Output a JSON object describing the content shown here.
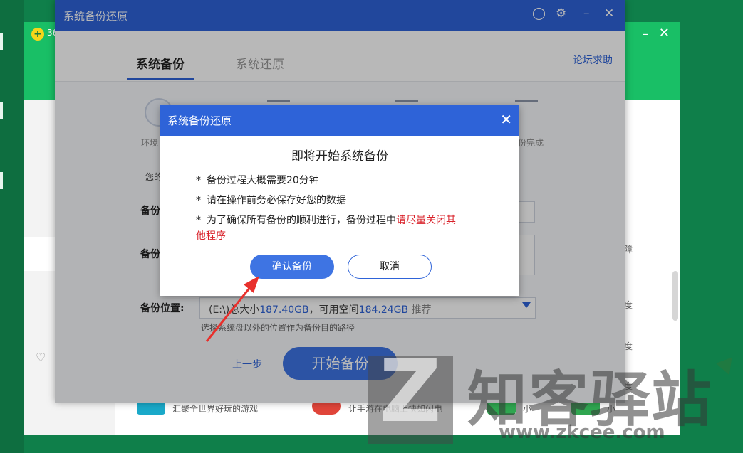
{
  "background_app": {
    "title_partial": "36",
    "right_labels": [
      "障",
      "度",
      "度",
      "度"
    ],
    "bottom_items": [
      "汇聚全世界好玩的游戏",
      "让手游在电脑上快如闪电",
      "小",
      "小"
    ]
  },
  "main_window": {
    "title": "系统备份还原",
    "icons": [
      "chat-icon",
      "gear-icon",
      "minimize-icon",
      "close-icon"
    ],
    "tabs": [
      "系统备份",
      "系统还原"
    ],
    "forum_link": "论坛求助",
    "steps": [
      "环境",
      "份完成"
    ],
    "hint_partial": "您的",
    "form_labels": [
      "备份",
      "备份",
      "备份位置:"
    ],
    "location": {
      "prefix": "(E:\\)",
      "total_label": "总大小",
      "total": "187.40GB",
      "sep": "，可用空间",
      "free": "184.24GB",
      "recommend": "推荐"
    },
    "location_hint": "选择系统盘以外的位置作为备份目的路径",
    "prev_button": "上一步",
    "start_button": "开始备份"
  },
  "dialog": {
    "title": "系统备份还原",
    "heading": "即将开始系统备份",
    "lines": [
      "备份过程大概需要20分钟",
      "请在操作前务必保存好您的数据",
      "为了确保所有备份的顺利进行，备份过程中"
    ],
    "line3_red_part1": "请尽量关闭其",
    "line3_red_part2": "他程序",
    "confirm_button": "确认备份",
    "cancel_button": "取消",
    "colors": {
      "primary": "#2e63d8",
      "warning": "#d9232b"
    }
  },
  "watermark": {
    "logo_letter": "Z",
    "text": "知客驿站",
    "url": "www.zkcee.com"
  }
}
